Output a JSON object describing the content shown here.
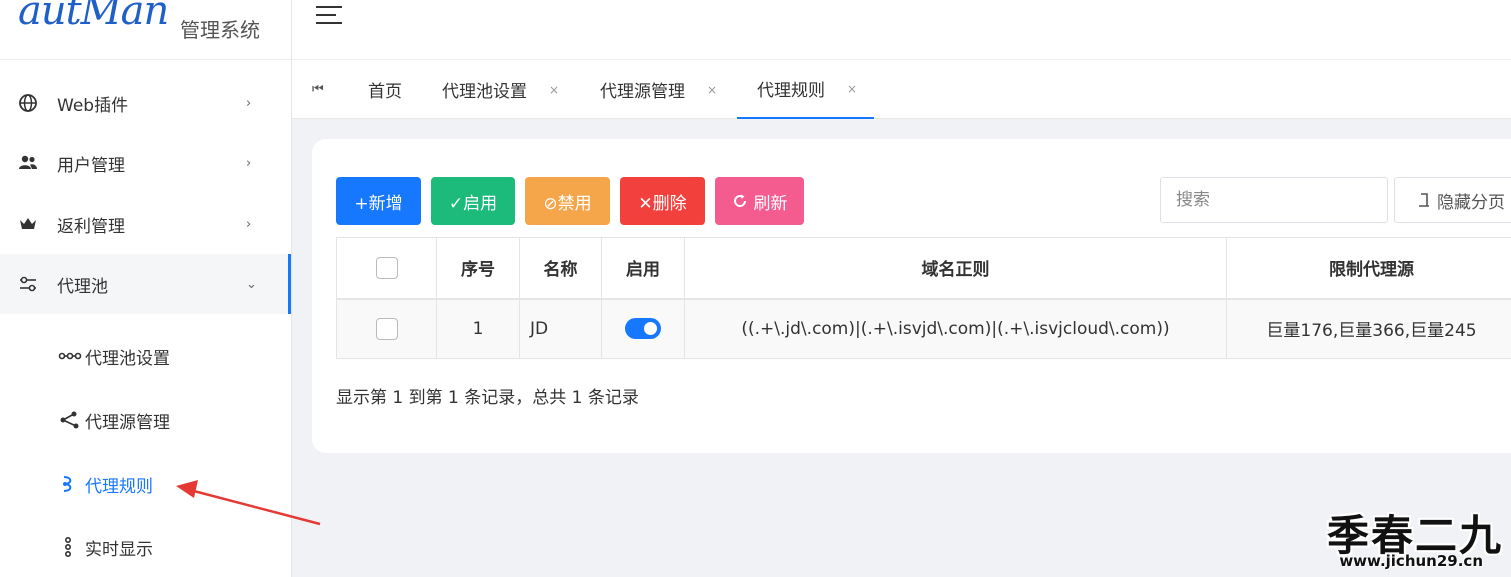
{
  "brand": {
    "script": "autMan",
    "title": "管理系统"
  },
  "sidebar": {
    "items": [
      {
        "label": "Web插件",
        "icon": "globe-icon",
        "arrow": "›"
      },
      {
        "label": "用户管理",
        "icon": "users-icon",
        "arrow": "›"
      },
      {
        "label": "返利管理",
        "icon": "crown-icon",
        "arrow": "›"
      },
      {
        "label": "代理池",
        "icon": "sliders-icon",
        "arrow": "⌄"
      }
    ],
    "subitems": [
      {
        "label": "代理池设置",
        "icon": "dots-chain-icon"
      },
      {
        "label": "代理源管理",
        "icon": "share-nodes-icon"
      },
      {
        "label": "代理规则",
        "icon": "rule-icon",
        "active": true
      },
      {
        "label": "实时显示",
        "icon": "vertical-dots-icon"
      }
    ]
  },
  "tabs": {
    "first_icon": "⏮",
    "items": [
      {
        "label": "首页",
        "closable": false
      },
      {
        "label": "代理池设置",
        "close": "×"
      },
      {
        "label": "代理源管理",
        "close": "×"
      },
      {
        "label": "代理规则",
        "close": "×",
        "active": true
      }
    ]
  },
  "toolbar": {
    "add": "+新增",
    "enable": "✓启用",
    "disable": "⊘禁用",
    "delete": "✕删除",
    "refresh": "刷新",
    "search_placeholder": "搜索",
    "hide_page": "隐藏分页"
  },
  "table": {
    "headers": [
      "序号",
      "名称",
      "启用",
      "域名正则",
      "限制代理源"
    ],
    "rows": [
      {
        "index": "1",
        "name": "JD",
        "enabled": true,
        "domain_regex": "((.+\\.jd\\.com)|(.+\\.isvjd\\.com)|(.+\\.isvjcloud\\.com))",
        "limit_sources": "巨量176,巨量366,巨量245"
      }
    ]
  },
  "pagination": {
    "summary": "显示第 1 到第 1 条记录，总共 1 条记录"
  },
  "watermark": {
    "main": "季春二九",
    "url": "www.jichun29.cn"
  },
  "colors": {
    "primary": "#1677ff",
    "success": "#1cbb7c",
    "warning": "#f5a64a",
    "danger": "#f2413d",
    "pink": "#f45b8f",
    "annotation_arrow": "#e53935"
  }
}
